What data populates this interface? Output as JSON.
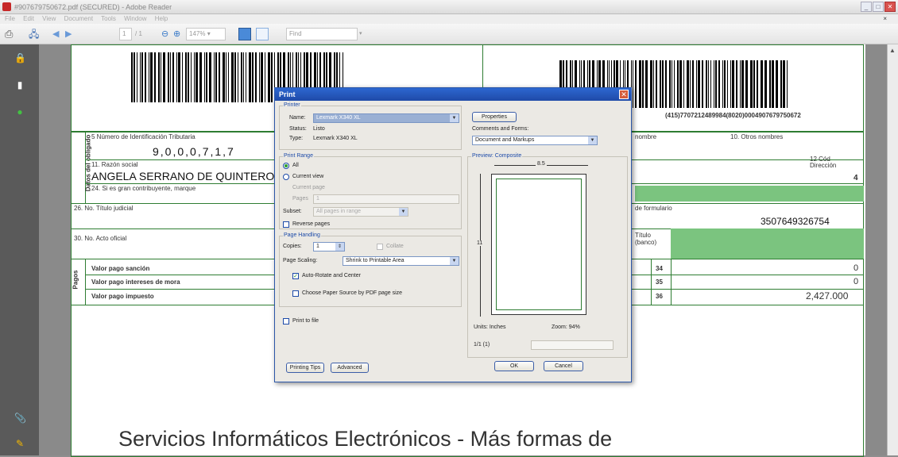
{
  "window": {
    "title": "#907679750672.pdf (SECURED) - Adobe Reader",
    "buttons": [
      "_",
      "□",
      "✕"
    ]
  },
  "menu": {
    "items": [
      "File",
      "Edit",
      "View",
      "Document",
      "Tools",
      "Window",
      "Help"
    ],
    "close": "×"
  },
  "toolbar": {
    "page_current": "1",
    "page_total": "/ 1",
    "zoom": "147%",
    "find_placeholder": "Find"
  },
  "document": {
    "row1_label": "5 Número de Identificación Tributaria",
    "nit_value": "9,0,0,0,7,1,7",
    "side_label": "Datos del obligado",
    "razon_label": "11. Razón social",
    "razon_value": "ANGELA SERRANO DE QUINTERO",
    "gran_contrib_label": "24. Si es gran contribuyente, marque",
    "titulo_label": "26. No. Título judicial",
    "acto_label": "30. No. Acto oficial",
    "pagos_label": "Pagos",
    "pago_rows": [
      {
        "label": "Valor pago sanción",
        "num": "34",
        "value": "0"
      },
      {
        "label": "Valor pago intereses de mora",
        "num": "35",
        "value": "0"
      },
      {
        "label": "Valor pago impuesto",
        "num": "36",
        "value": "2,427.000"
      }
    ],
    "nombre_label": "nombre",
    "otros_nombres_label": "10. Otros nombres",
    "cod_label": "12 Cód",
    "direccion_label": "Dirección",
    "seccional_value": "4",
    "formulario_label": "de formulario",
    "formulario_value": "3507649326754",
    "titulo_banco_label": "Título (banco)",
    "barcode_number": "(415)7707212489984(8020)0004907679750672",
    "footer_banner": "Servicios Informáticos Electrónicos  -  Más formas de"
  },
  "print_dialog": {
    "title": "Print",
    "printer_group": "Printer",
    "name_label": "Name:",
    "name_value": "Lexmark X340 XL",
    "status_label": "Status:",
    "status_value": "Listo",
    "type_label": "Type:",
    "type_value": "Lexmark X340 XL",
    "properties_btn": "Properties",
    "comments_label": "Comments and Forms:",
    "comments_value": "Document and Markups",
    "print_range_group": "Print Range",
    "range_all": "All",
    "range_current": "Current view",
    "range_current_page": "Current page",
    "range_pages": "Pages",
    "pages_value": "1",
    "subset_label": "Subset:",
    "subset_value": "All pages in range",
    "reverse_pages": "Reverse pages",
    "page_handling_group": "Page Handling",
    "copies_label": "Copies:",
    "copies_value": "1",
    "collate_label": "Collate",
    "page_scaling_label": "Page Scaling:",
    "page_scaling_value": "Shrink to Printable Area",
    "auto_rotate": "Auto-Rotate and Center",
    "choose_paper": "Choose Paper Source by PDF page size",
    "print_to_file": "Print to file",
    "preview_group": "Preview: Composite",
    "preview_width": "8.5",
    "preview_height": "11",
    "units_label": "Units: Inches",
    "zoom_label": "Zoom: 94%",
    "page_counter": "1/1 (1)",
    "printing_tips_btn": "Printing Tips",
    "advanced_btn": "Advanced",
    "ok_btn": "OK",
    "cancel_btn": "Cancel"
  }
}
